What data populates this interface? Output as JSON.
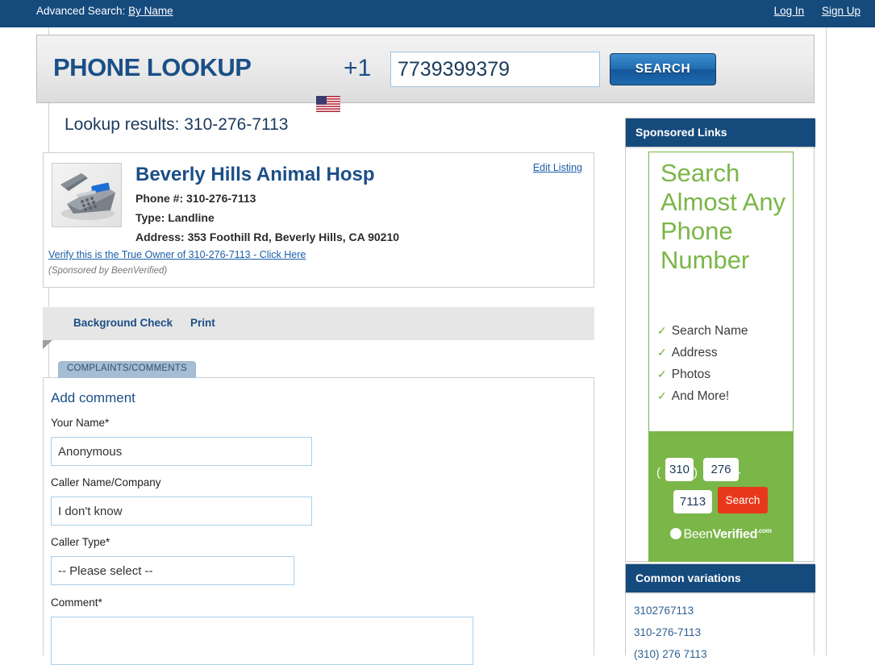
{
  "topnav": {
    "advanced_label": "Advanced Search:",
    "advanced_link": "By Name",
    "login": "Log In",
    "signup": "Sign Up"
  },
  "ribbon": {
    "title": "PHONE LOOKUP",
    "country_code": "+1",
    "flag_icon": "us-flag-icon",
    "phone_value": "7739399379",
    "phone_placeholder": "",
    "search_button": "SEARCH"
  },
  "results": {
    "heading": "Lookup results: 310-276-7113",
    "listing": {
      "thumb_icon": "desk-phone-icon",
      "business_name": "Beverly Hills Animal Hosp",
      "phone_line": "Phone #: 310-276-7113",
      "type_line": "Type: Landline",
      "address_line": "Address: 353 Foothill Rd, Beverly Hills, CA 90210",
      "edit_listing": "Edit Listing",
      "verify_link": "Verify this is the True Owner of 310-276-7113 - Click Here",
      "sponsored_note": "(Sponsored by BeenVerified)"
    }
  },
  "actionbar": {
    "background_check": "Background Check",
    "print": "Print"
  },
  "tabs": {
    "complaints": "COMPLAINTS/COMMENTS"
  },
  "comment_form": {
    "title": "Add comment",
    "name_label": "Your Name*",
    "name_value": "Anonymous",
    "caller_label": "Caller Name/Company",
    "caller_value": "I don't know",
    "type_label": "Caller Type*",
    "type_value": "-- Please select --",
    "comment_label": "Comment*",
    "comment_value": ""
  },
  "sidebar": {
    "sponsored_header": "Sponsored Links",
    "ad": {
      "headline": "Search Almost Any Phone Number",
      "bullets": [
        "Search Name",
        "Address",
        "Photos",
        "And More!"
      ],
      "check_icon": "check-icon",
      "paren_left": "(",
      "paren_right": ")",
      "dash": "-",
      "area_code": "310",
      "prefix": "276",
      "line_number": "7113",
      "search_button": "Search",
      "brand_mark_icon": "beenverified-logo-icon",
      "brand_been": "Been",
      "brand_verified": "Verified",
      "brand_dot": ".com"
    },
    "variations_header": "Common variations",
    "variations": [
      "3102767113",
      "310-276-7113",
      "(310) 276 7113"
    ]
  },
  "colors": {
    "navy": "#154a7d",
    "link_blue": "#1b5fa8",
    "ad_green": "#7ab648",
    "ad_red": "#e8381b",
    "tab_blue": "#a6bed4"
  }
}
